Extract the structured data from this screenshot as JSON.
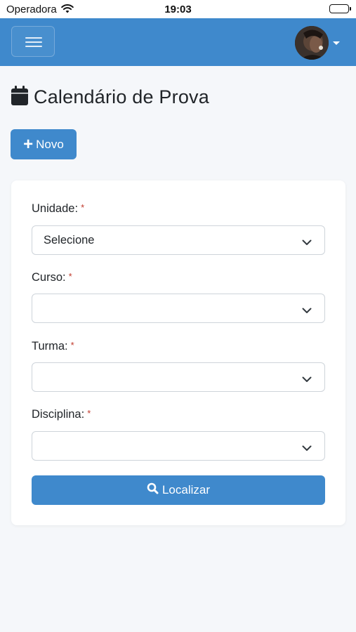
{
  "status_bar": {
    "carrier": "Operadora",
    "time": "19:03"
  },
  "navbar": {
    "menu_icon": "hamburger-icon",
    "avatar": "user-avatar",
    "caret_icon": "caret-down-icon"
  },
  "page": {
    "title": "Calendário de Prova",
    "title_icon": "calendar-icon"
  },
  "actions": {
    "new_label": "Novo",
    "new_icon": "plus-icon"
  },
  "form": {
    "fields": [
      {
        "label": "Unidade:",
        "required_mark": "*",
        "value": "Selecione"
      },
      {
        "label": "Curso:",
        "required_mark": "*",
        "value": ""
      },
      {
        "label": "Turma:",
        "required_mark": "*",
        "value": ""
      },
      {
        "label": "Disciplina:",
        "required_mark": "*",
        "value": ""
      }
    ],
    "submit_label": "Localizar",
    "submit_icon": "search-icon"
  },
  "colors": {
    "primary": "#3f89cc",
    "background": "#f5f7fa",
    "required": "#c0392b"
  }
}
